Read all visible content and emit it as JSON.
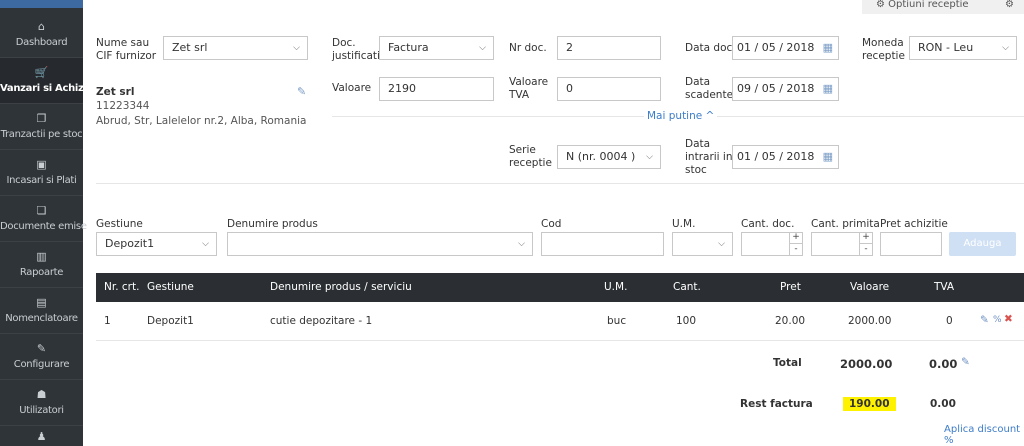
{
  "sidebar": {
    "items": [
      {
        "label": "Dashboard",
        "icon": "home-icon",
        "glyph": "⌂"
      },
      {
        "label": "Vanzari si Achizitii",
        "icon": "cart-icon",
        "glyph": "🛒"
      },
      {
        "label": "Tranzactii pe stoc",
        "icon": "copy-icon",
        "glyph": "❐"
      },
      {
        "label": "Incasari si Plati",
        "icon": "money-icon",
        "glyph": "▣"
      },
      {
        "label": "Documente emise",
        "icon": "documents-icon",
        "glyph": "❏"
      },
      {
        "label": "Rapoarte",
        "icon": "chart-icon",
        "glyph": "▥"
      },
      {
        "label": "Nomenclatoare",
        "icon": "list-icon",
        "glyph": "▤"
      },
      {
        "label": "Configurare",
        "icon": "wrench-icon",
        "glyph": "✎"
      },
      {
        "label": "Utilizatori",
        "icon": "users-icon",
        "glyph": "☗"
      },
      {
        "label": "",
        "icon": "user-icon",
        "glyph": "♟"
      }
    ]
  },
  "options_bar": {
    "label": "⚙ Optiuni receptie",
    "gear": "⚙"
  },
  "form": {
    "supplier_label": "Nume sau CIF furnizor",
    "supplier_value": "Zet srl",
    "supplier_name": "Zet srl",
    "supplier_cif": "11223344",
    "supplier_address": "Abrud, Str, Lalelelor nr.2, Alba, Romania",
    "doc_just_label": "Doc. justificativ",
    "doc_just_value": "Factura",
    "nr_doc_label": "Nr doc.",
    "nr_doc_value": "2",
    "data_doc_label": "Data doc.",
    "data_doc_value": "01 / 05 / 2018",
    "moneda_label": "Moneda receptie",
    "moneda_value": "RON - Leu",
    "valoare_label": "Valoare",
    "valoare_value": "2190",
    "valoare_tva_label": "Valoare TVA",
    "valoare_tva_value": "0",
    "data_scad_label": "Data scadentei",
    "data_scad_value": "09 / 05 / 2018",
    "mai_putine": "Mai putine ^",
    "serie_label": "Serie receptie",
    "serie_value": "N (nr. 0004 )",
    "data_intrarii_label": "Data intrarii in stoc",
    "data_intrarii_value": "01 / 05 / 2018"
  },
  "add_row": {
    "gestiune_label": "Gestiune",
    "gestiune_value": "Depozit1",
    "denumire_label": "Denumire produs",
    "cod_label": "Cod",
    "um_label": "U.M.",
    "cant_doc_label": "Cant. doc.",
    "cant_primita_label": "Cant. primita",
    "pret_label": "Pret achizitie",
    "adauga_label": "Adauga"
  },
  "table": {
    "headers": [
      "Nr. crt.",
      "Gestiune",
      "Denumire produs / serviciu",
      "U.M.",
      "Cant.",
      "Pret",
      "Valoare",
      "TVA"
    ],
    "rows": [
      {
        "nr": "1",
        "gestiune": "Depozit1",
        "denumire": "cutie depozitare - 1",
        "um": "buc",
        "cant": "100",
        "pret": "20.00",
        "valoare": "2000.00",
        "tva": "0"
      }
    ],
    "total_label": "Total",
    "total_valoare": "2000.00",
    "total_tva": "0.00",
    "rest_label": "Rest factura",
    "rest_valoare": "190.00",
    "rest_tva": "0.00",
    "discount_link": "Aplica discount %"
  },
  "colors": {
    "sidebar_bg": "#2f3438",
    "table_header_bg": "#2b2f33",
    "link": "#3d7cc9",
    "highlight": "#fff200"
  }
}
